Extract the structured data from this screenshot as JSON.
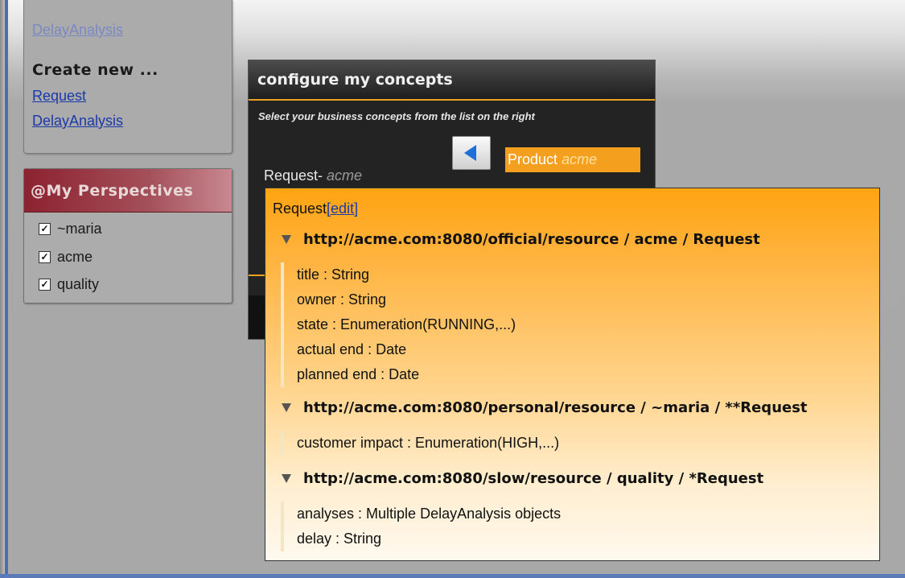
{
  "sidebar": {
    "previous_link": "DelayAnalysis",
    "create_heading": "Create new ...",
    "create_links": [
      "Request",
      "DelayAnalysis"
    ],
    "perspectives": {
      "title": "My Perspectives",
      "items": [
        {
          "label": "~maria",
          "checked": true
        },
        {
          "label": "acme",
          "checked": true
        },
        {
          "label": "quality",
          "checked": true
        }
      ]
    }
  },
  "configure": {
    "title": "configure my concepts",
    "subtitle": "Select your business concepts from the list on the right",
    "left_item": "Request",
    "left_item_scope": "acme",
    "selected_item": "Product",
    "selected_item_scope": "acme"
  },
  "popup": {
    "title": "Request",
    "edit_link": "[edit]",
    "sections": [
      {
        "title": "http://acme.com:8080/official/resource / acme / Request",
        "attributes": [
          "title : String",
          "owner : String",
          "state : Enumeration(RUNNING,...)",
          "actual end : Date",
          "planned end : Date"
        ]
      },
      {
        "title": "http://acme.com:8080/personal/resource / ~maria / **Request",
        "attributes": [
          "customer impact : Enumeration(HIGH,...)"
        ]
      },
      {
        "title": "http://acme.com:8080/slow/resource / quality / *Request",
        "attributes": [
          "analyses : Multiple DelayAnalysis objects",
          "delay : String"
        ]
      }
    ]
  },
  "colors": {
    "accent_orange": "#f4a01e",
    "perspectives_header": "#8c2230",
    "link_blue": "#1b3aa8"
  }
}
